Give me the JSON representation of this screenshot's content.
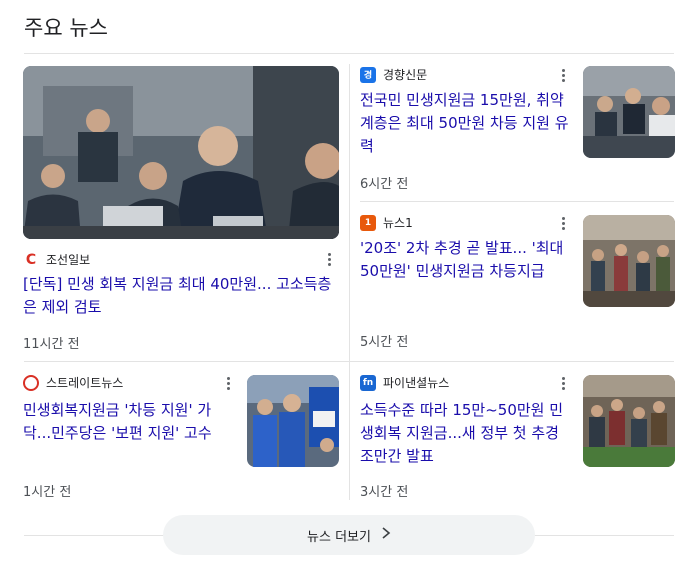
{
  "section_title": "주요 뉴스",
  "articles": [
    {
      "source": "조선일보",
      "headline": "[단독] 민생 회복 지원금 최대 40만원... 고소득층은 제외 검토",
      "time": "11시간 전",
      "logo_color": "#d93025"
    },
    {
      "source": "경향신문",
      "headline": "전국민 민생지원금 15만원, 취약계층은 최대 50만원 차등 지원 유력",
      "time": "6시간 전",
      "logo_color": "#1a73e8"
    },
    {
      "source": "뉴스1",
      "headline": "'20조' 2차 추경 곧 발표... '최대 50만원' 민생지원금 차등지급",
      "time": "5시간 전",
      "logo_color": "#e8590c"
    },
    {
      "source": "스트레이트뉴스",
      "headline": "민생회복지원금 '차등 지원' 가닥...민주당은 '보편 지원' 고수",
      "time": "1시간 전",
      "logo_color": "#d93025"
    },
    {
      "source": "파이낸셜뉴스",
      "headline": "소득수준 따라 15만~50만원 민생회복 지원금...새 정부 첫 추경 조만간 발표",
      "time": "3시간 전",
      "logo_color": "#1967d2"
    }
  ],
  "more_button": "뉴스 더보기",
  "colors": {
    "link": "#1a0dab",
    "meta": "#4d5156",
    "divider": "#e3e3e3"
  }
}
